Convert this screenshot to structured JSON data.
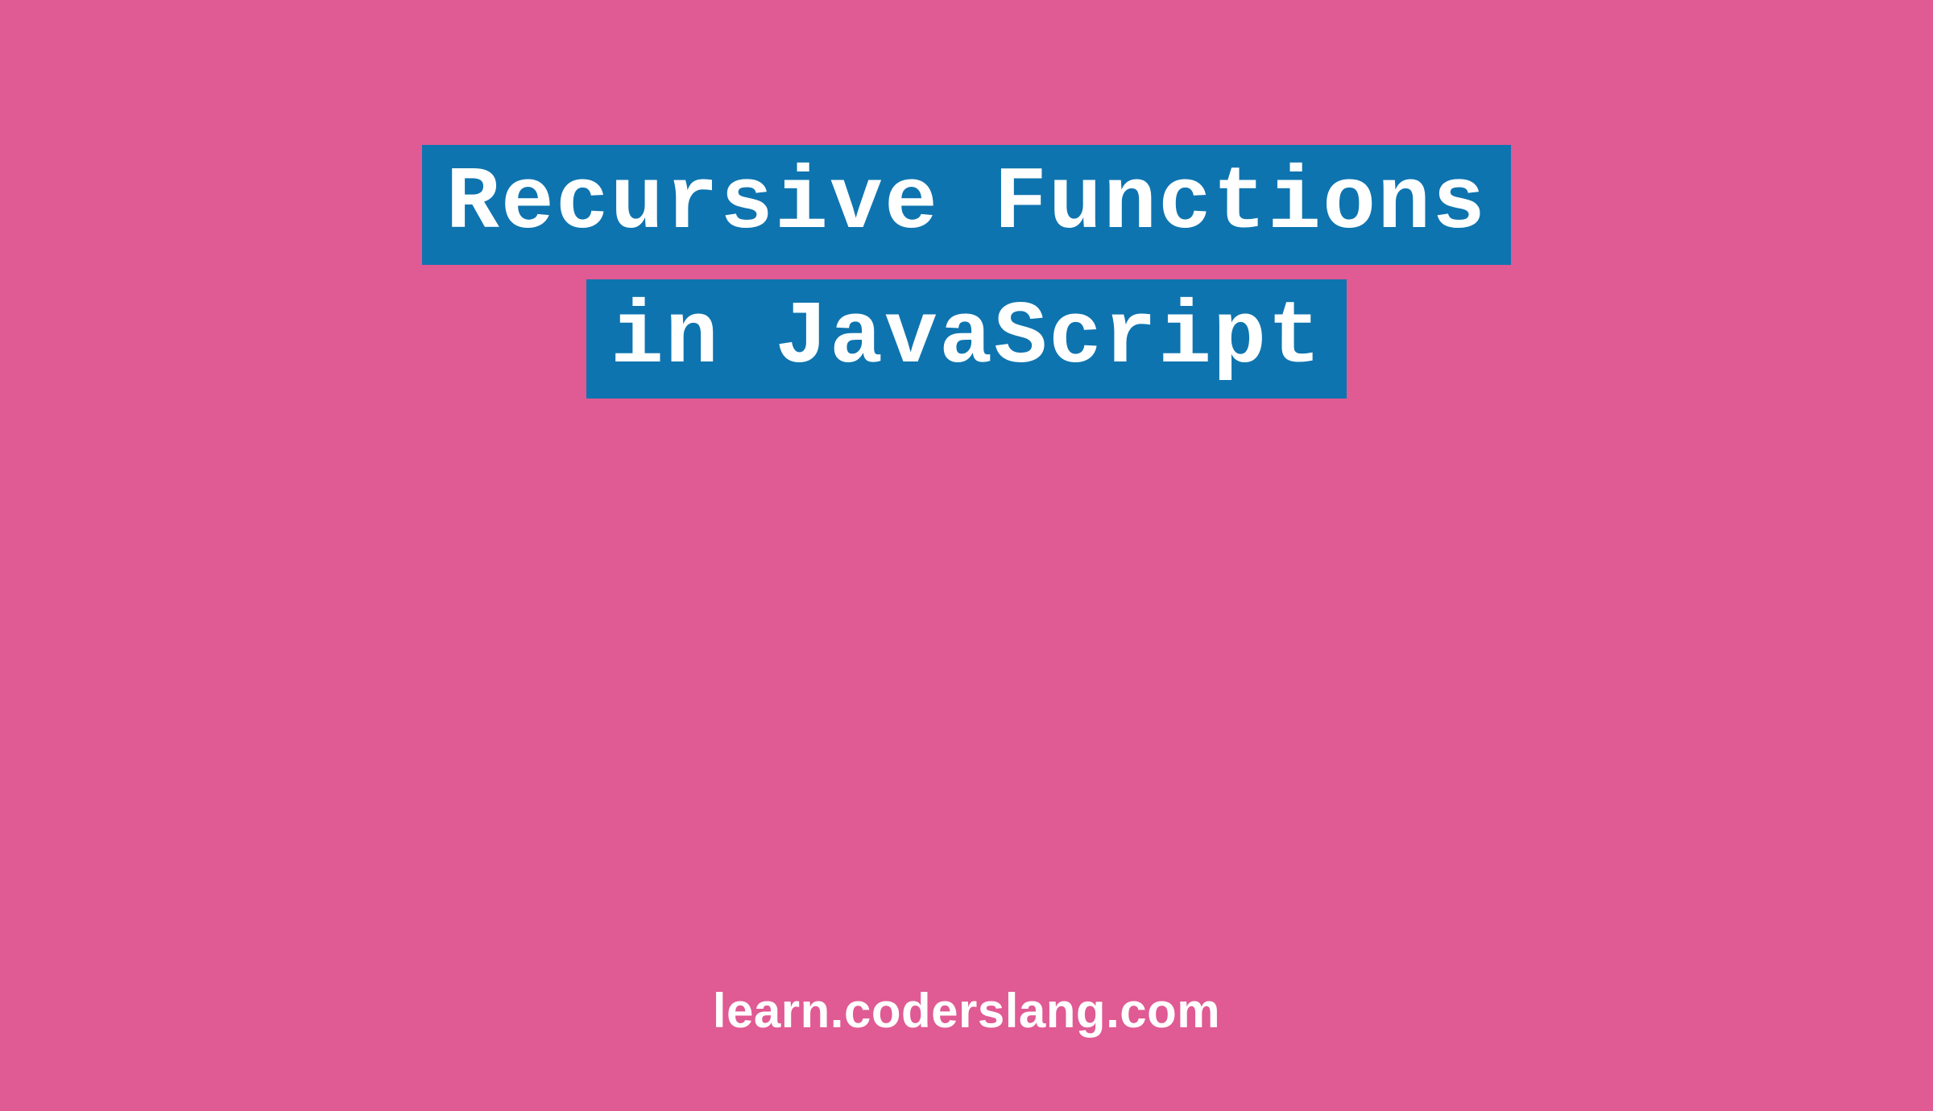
{
  "title": {
    "line1": "Recursive Functions",
    "line2": "in JavaScript"
  },
  "footer": {
    "url": "learn.coderslang.com"
  },
  "colors": {
    "background": "#E05A93",
    "highlight": "#0E74AF",
    "text": "#FFFFFF"
  }
}
